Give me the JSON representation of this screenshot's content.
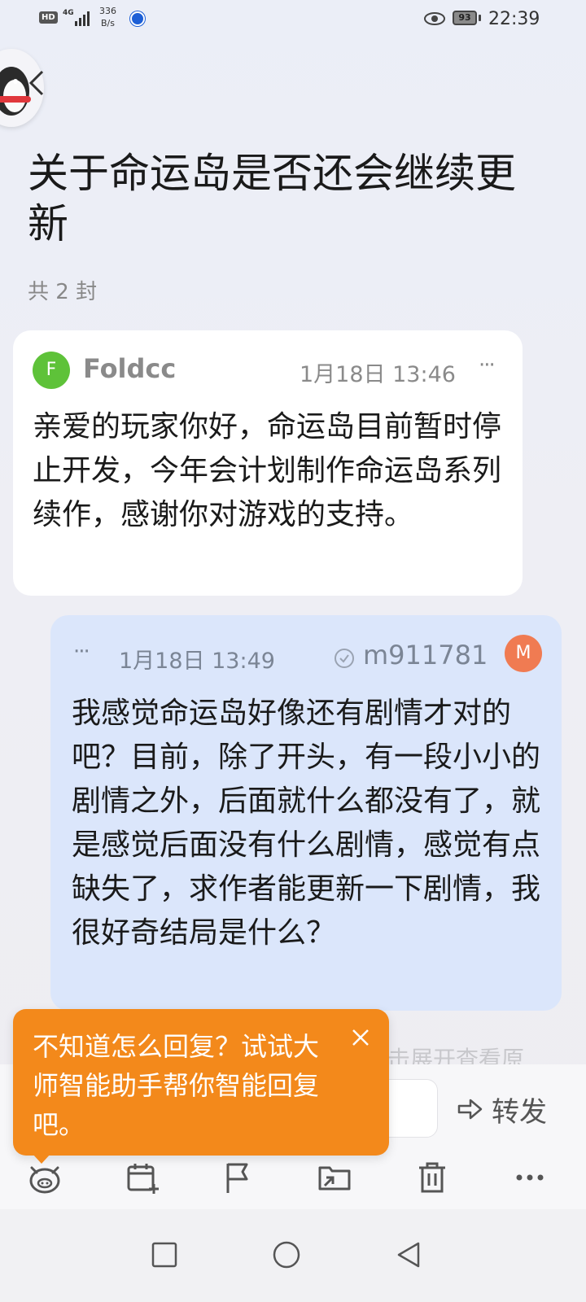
{
  "status_bar": {
    "hd": "HD",
    "network": "4G",
    "speed_value": "336",
    "speed_unit": "B/s",
    "battery": "93",
    "time": "22:39"
  },
  "header": {
    "title": "关于命运岛是否还会继续更新",
    "count": "共 2 封"
  },
  "messages": [
    {
      "avatar_letter": "F",
      "sender": "Foldcc",
      "time": "1月18日 13:46",
      "more": "···",
      "body": "亲爱的玩家你好，命运岛目前暂时停止开发，今年会计划制作命运岛系列续作，感谢你对游戏的支持。",
      "avatar_color": "#5ec239"
    },
    {
      "avatar_letter": "M",
      "sender": "m911781",
      "time": "1月18日 13:49",
      "more": "···",
      "body": "我感觉命运岛好像还有剧情才对的吧？目前，除了开头，有一段小小的剧情之外，后面就什么都没有了，就是感觉后面没有什么剧情，感觉有点缺失了，求作者能更新一下剧情，我很好奇结局是什么？",
      "avatar_color": "#f07b52"
    }
  ],
  "expand_hint": "击展开查看原",
  "reply": {
    "forward_label": "转发"
  },
  "tooltip": {
    "text": "不知道怎么回复？试试大师智能助手帮你智能回复吧。",
    "color": "#f3891b"
  },
  "toolbar": {
    "icons": [
      "assistant-icon",
      "calendar-add-icon",
      "flag-icon",
      "move-folder-icon",
      "trash-icon",
      "more-icon"
    ]
  }
}
